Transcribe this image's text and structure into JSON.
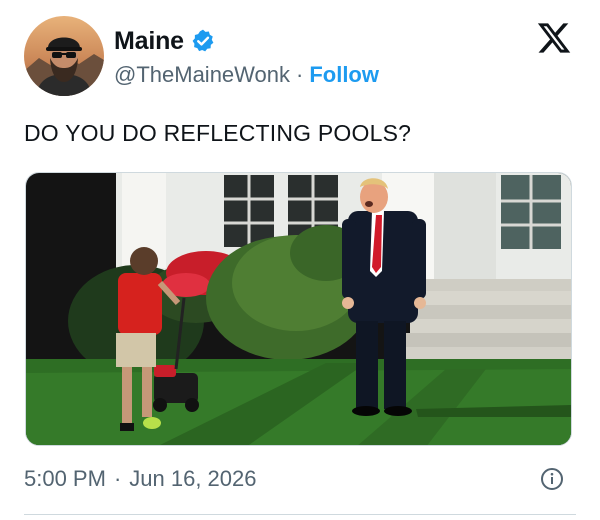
{
  "author": {
    "display_name": "Maine",
    "handle": "@TheMaineWonk",
    "separator": "·",
    "follow_label": "Follow",
    "verified_color": "#1d9bf0"
  },
  "tweet": {
    "text": "DO YOU DO REFLECTING POOLS?"
  },
  "footer": {
    "time": "5:00 PM",
    "separator": "·",
    "date": "Jun 16, 2026"
  },
  "icons": {
    "brand": "x-logo-icon",
    "info": "info-icon",
    "verified": "verified-badge-icon"
  },
  "colors": {
    "link": "#1d9bf0",
    "secondary_text": "#536471",
    "primary_text": "#0f1419",
    "border": "#cfd9de"
  }
}
